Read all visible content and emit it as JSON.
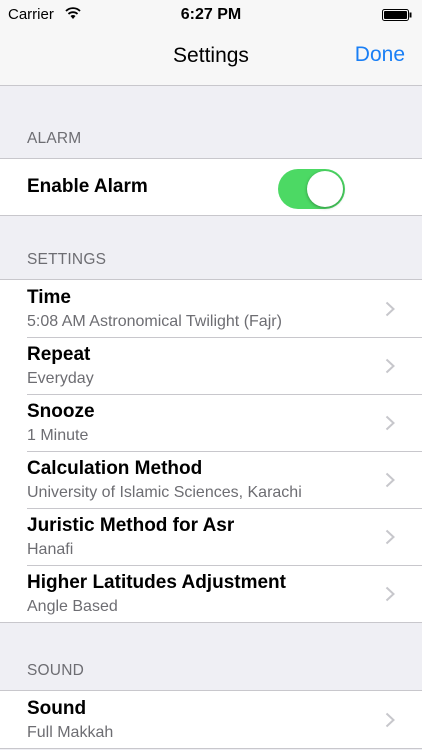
{
  "status_bar": {
    "carrier": "Carrier",
    "time": "6:27 PM"
  },
  "nav": {
    "title": "Settings",
    "done_label": "Done"
  },
  "alarm_section": {
    "header": "ALARM",
    "enable_label": "Enable Alarm",
    "enabled": true
  },
  "settings_section": {
    "header": "SETTINGS",
    "rows": [
      {
        "title": "Time",
        "subtitle": "5:08 AM Astronomical Twilight (Fajr)"
      },
      {
        "title": "Repeat",
        "subtitle": "Everyday"
      },
      {
        "title": "Snooze",
        "subtitle": "1 Minute"
      },
      {
        "title": "Calculation Method",
        "subtitle": "University of Islamic Sciences, Karachi"
      },
      {
        "title": "Juristic Method for Asr",
        "subtitle": "Hanafi"
      },
      {
        "title": "Higher Latitudes Adjustment",
        "subtitle": "Angle Based"
      }
    ]
  },
  "sound_section": {
    "header": "SOUND",
    "rows": [
      {
        "title": "Sound",
        "subtitle": "Full Makkah"
      }
    ]
  },
  "colors": {
    "accent": "#1a7ff5",
    "toggle_on": "#4cd964",
    "background": "#efeff4"
  }
}
